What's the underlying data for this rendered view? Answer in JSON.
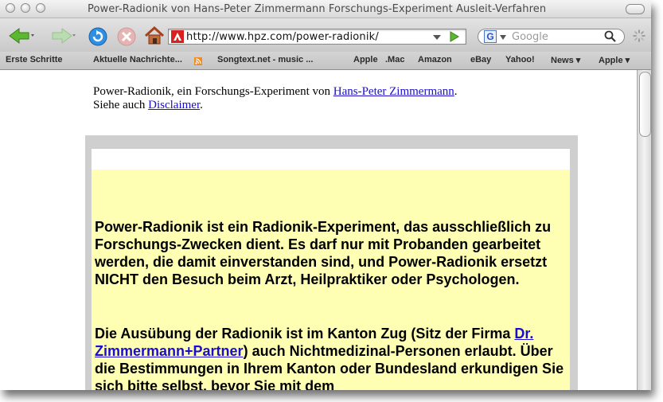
{
  "window": {
    "title": "Power-Radionik von Hans-Peter Zimmermann Forschungs-Experiment Ausleit-Verfahren"
  },
  "toolbar": {
    "url": "http://www.hpz.com/power-radionik/",
    "search_placeholder": "Google"
  },
  "bookmarks": [
    {
      "label": "Erste Schritte"
    },
    {
      "label": "Aktuelle Nachrichte..."
    },
    {
      "label": "Songtext.net - music ..."
    },
    {
      "label": "Apple"
    },
    {
      "label": ".Mac"
    },
    {
      "label": "Amazon"
    },
    {
      "label": "eBay"
    },
    {
      "label": "Yahoo!"
    },
    {
      "label": "News ▾"
    },
    {
      "label": "Apple ▾"
    }
  ],
  "page": {
    "intro_prefix": "Power-Radionik, ein Forschungs-Experiment von ",
    "intro_link": "Hans-Peter Zimmermann",
    "intro_suffix": ".",
    "see_also_prefix": "Siehe auch ",
    "see_also_link": "Disclaimer",
    "see_also_suffix": ".",
    "para1": "Power-Radionik ist ein Radionik-Experiment, das ausschließlich zu Forschungs-Zwecken dient. Es darf nur mit Probanden gearbeitet werden, die damit einverstanden sind, und Power-Radionik ersetzt NICHT den Besuch beim Arzt, Heilpraktiker oder Psychologen.",
    "para2_prefix": "Die Ausübung der Radionik ist im Kanton Zug (Sitz der Firma ",
    "para2_link": "Dr. Zimmermann+Partner",
    "para2_suffix": ") auch Nichtmedizinal-Personen erlaubt. Über die Bestimmungen in Ihrem Kanton oder Bundesland erkundigen Sie sich bitte selbst, bevor Sie mit dem"
  },
  "colors": {
    "link": "#1a0dcc",
    "notice_background": "#ffffb3",
    "frame_gray": "#cfcfcf"
  }
}
